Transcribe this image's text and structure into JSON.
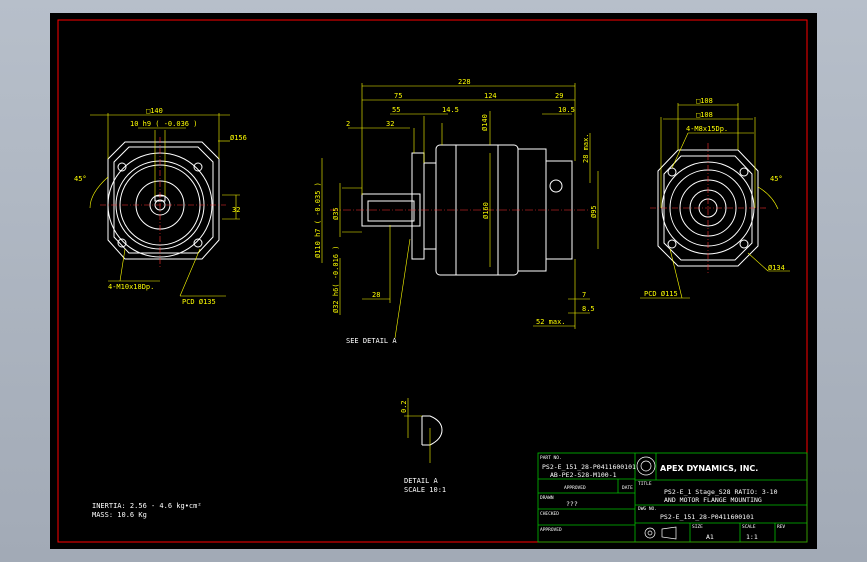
{
  "colors": {
    "background": "#000000",
    "part": "#ffffff",
    "dimension": "#ffff00",
    "center": "#ff3030",
    "border": "#ff0000",
    "titleblock": "#00c000"
  },
  "left_view": {
    "square": "□140",
    "bore": "10 h9 ( -0.036 )",
    "diameter": "Ø156",
    "angle": "45°",
    "bolt": "4-M10x18Dp.",
    "pcd": "PCD Ø135",
    "side": "32"
  },
  "side_view": {
    "overall": "228",
    "d75": "75",
    "d124": "124",
    "d29": "29",
    "d55": "55",
    "d145": "14.5",
    "d105": "10.5",
    "d2": "2",
    "d32": "32",
    "d140": "Ø140",
    "d28max": "28 max.",
    "shaft_d": "Ø110 h7 ( -0.035 )",
    "d35": "Ø35",
    "d160": "Ø160",
    "d95": "Ø95",
    "shaft": "Ø32 h6( -0.016 )",
    "d28": "28",
    "d7": "7",
    "d85": "8.5",
    "d52max": "52 max."
  },
  "right_view": {
    "square": "□108",
    "bolt": "4-M8x15Dp.",
    "angle": "45°",
    "pcd": "PCD Ø115",
    "diameter": "Ø134"
  },
  "detail": {
    "callout": "SEE DETAIL A",
    "d02": "0.2",
    "title": "DETAIL A",
    "scale": "SCALE 10:1"
  },
  "notes": {
    "inertia": "INERTIA: 2.56 - 4.6 kg•cm²",
    "mass": "MASS: 10.6 Kg"
  },
  "title_block": {
    "part_no_label": "PART NO.",
    "part_no_1": "PS2-E_151_28-P0411600101",
    "part_no_2": "AB-PE2-S28-M100-1",
    "approved_label": "APPROVED",
    "date_label": "DATE",
    "drawn_label": "DRAWN",
    "drawn_value": "???",
    "checked_label": "CHECKED",
    "approved2_label": "APPROVED",
    "company": "APEX DYNAMICS, INC.",
    "title_label": "TITLE",
    "title_1": "PS2-E_1 Stage_S28   RATIO: 3-10",
    "title_2": "AND MOTOR FLANGE MOUNTING",
    "dwg_label": "DWG NO.",
    "dwg_no": "PS2-E_151_28-P0411600101",
    "size_label": "SIZE",
    "size": "A1",
    "scale_label": "SCALE",
    "scale": "1:1",
    "rev_label": "REV"
  }
}
